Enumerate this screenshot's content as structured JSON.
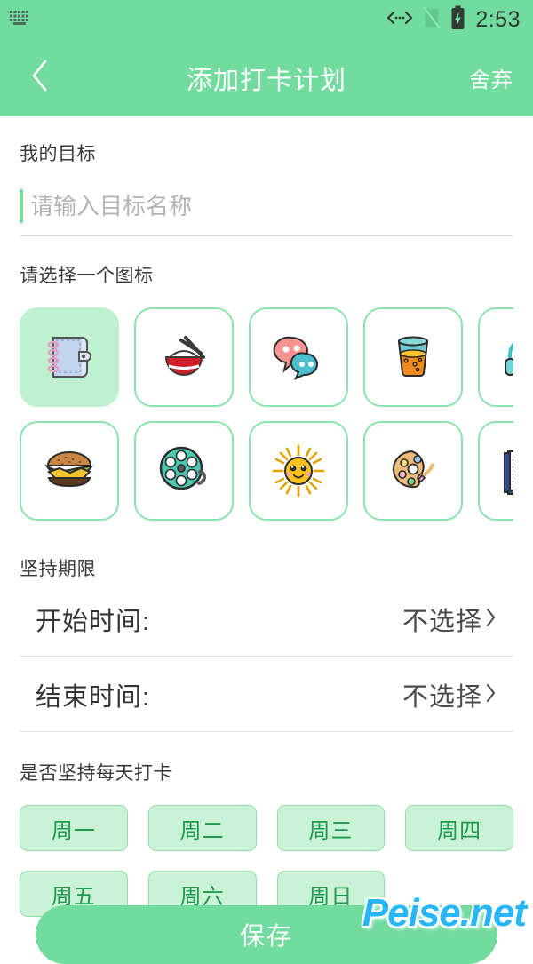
{
  "statusbar": {
    "notification_icon": "keyboard-icon",
    "usb_icon": "usb-debug-icon",
    "signal_icon": "signal-off-icon",
    "battery_icon": "battery-charging-icon",
    "time": "2:53"
  },
  "appbar": {
    "back_icon": "chevron-left-icon",
    "title": "添加打卡计划",
    "discard_label": "舍弃",
    "bg_color": "#72DB9E"
  },
  "goal": {
    "section_label": "我的目标",
    "placeholder": "请输入目标名称",
    "value": "",
    "caret_color": "#76dd9f"
  },
  "icons": {
    "section_label": "请选择一个图标",
    "selected_index": 0,
    "rows": [
      [
        {
          "name": "notebook-icon",
          "selected": true
        },
        {
          "name": "rice-bowl-icon",
          "selected": false
        },
        {
          "name": "chat-bubbles-icon",
          "selected": false
        },
        {
          "name": "juice-glass-icon",
          "selected": false
        },
        {
          "name": "headphones-icon",
          "selected": false
        }
      ],
      [
        {
          "name": "hamburger-icon",
          "selected": false
        },
        {
          "name": "film-reel-icon",
          "selected": false
        },
        {
          "name": "sun-icon",
          "selected": false
        },
        {
          "name": "paint-palette-icon",
          "selected": false
        },
        {
          "name": "blue-book-icon",
          "selected": false
        }
      ]
    ]
  },
  "duration": {
    "section_label": "坚持期限",
    "rows": [
      {
        "label": "开始时间:",
        "value": "不选择"
      },
      {
        "label": "结束时间:",
        "value": "不选择"
      }
    ]
  },
  "weekday": {
    "section_label": "是否坚持每天打卡",
    "days": [
      "周一",
      "周二",
      "周三",
      "周四",
      "周五",
      "周六",
      "周日"
    ],
    "fill_color": "#C9F2D7",
    "text_color": "#1F9A4D"
  },
  "save": {
    "label": "保存"
  },
  "watermark": {
    "text": "Peise.net",
    "color": "#29B6F6"
  }
}
